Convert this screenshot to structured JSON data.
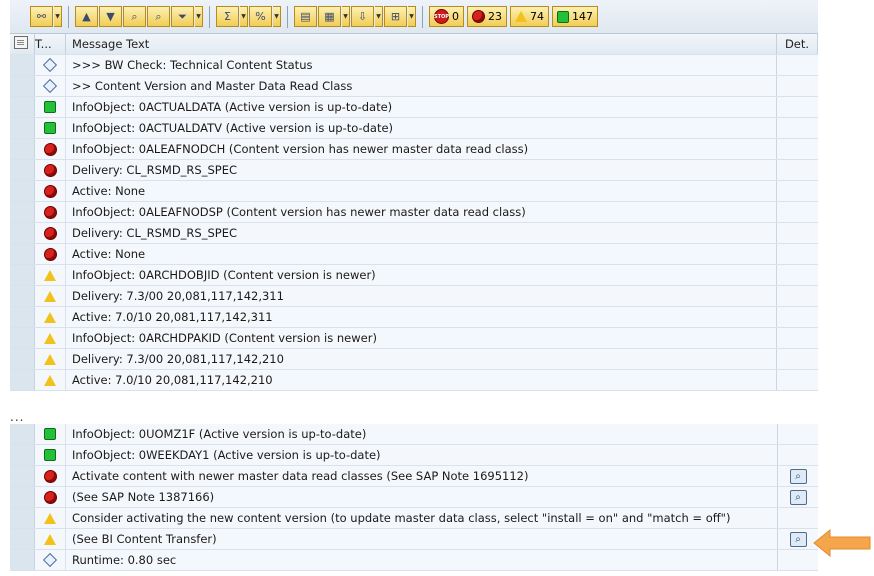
{
  "toolbar": {
    "counters": [
      {
        "icon": "stop-icon",
        "value": "0"
      },
      {
        "icon": "error-icon",
        "value": "23"
      },
      {
        "icon": "warning-icon",
        "value": "74"
      },
      {
        "icon": "success-icon",
        "value": "147"
      }
    ]
  },
  "table": {
    "headers": {
      "type": "T...",
      "message": "Message Text",
      "details": "Det."
    },
    "top_rows": [
      {
        "type": "info",
        "text": ">>> BW Check: Technical Content Status"
      },
      {
        "type": "info",
        "text": ">> Content Version and Master Data Read Class"
      },
      {
        "type": "ok",
        "text": "InfoObject: 0ACTUALDATA (Active version is up-to-date)"
      },
      {
        "type": "ok",
        "text": "InfoObject: 0ACTUALDATV (Active version is up-to-date)"
      },
      {
        "type": "error",
        "text": "InfoObject: 0ALEAFNODCH (Content version has newer master data read class)"
      },
      {
        "type": "error",
        "text": "Delivery: CL_RSMD_RS_SPEC"
      },
      {
        "type": "error",
        "text": "Active: None"
      },
      {
        "type": "error",
        "text": "InfoObject: 0ALEAFNODSP (Content version has newer master data read class)"
      },
      {
        "type": "error",
        "text": "Delivery: CL_RSMD_RS_SPEC"
      },
      {
        "type": "error",
        "text": "Active: None"
      },
      {
        "type": "warning",
        "text": "InfoObject: 0ARCHDOBJID (Content version is newer)"
      },
      {
        "type": "warning",
        "text": "Delivery: 7.3/00 20,081,117,142,311"
      },
      {
        "type": "warning",
        "text": "Active: 7.0/10 20,081,117,142,311"
      },
      {
        "type": "warning",
        "text": "InfoObject: 0ARCHDPAKID (Content version is newer)"
      },
      {
        "type": "warning",
        "text": "Delivery: 7.3/00 20,081,117,142,210"
      },
      {
        "type": "warning",
        "text": "Active: 7.0/10 20,081,117,142,210"
      }
    ],
    "ellipsis": "...",
    "bottom_rows": [
      {
        "type": "ok",
        "text": "InfoObject: 0UOMZ1F (Active version is up-to-date)",
        "detail": false
      },
      {
        "type": "ok",
        "text": "InfoObject: 0WEEKDAY1 (Active version is up-to-date)",
        "detail": false
      },
      {
        "type": "error",
        "text": "Activate content with newer master data read classes (See SAP Note 1695112)",
        "detail": true
      },
      {
        "type": "error",
        "text": "(See SAP Note 1387166)",
        "detail": true
      },
      {
        "type": "warning",
        "text": "Consider activating the new content version (to update master data class, select \"install = on\" and \"match = off\")",
        "detail": false
      },
      {
        "type": "warning",
        "text": "(See BI Content Transfer)",
        "detail": true
      },
      {
        "type": "info",
        "text": "Runtime: 0.80 sec",
        "detail": false
      }
    ]
  },
  "colors": {
    "callout_arrow": "#f5a54a",
    "error": "#d6211c",
    "warning": "#f1c21b",
    "ok": "#25c03a"
  }
}
